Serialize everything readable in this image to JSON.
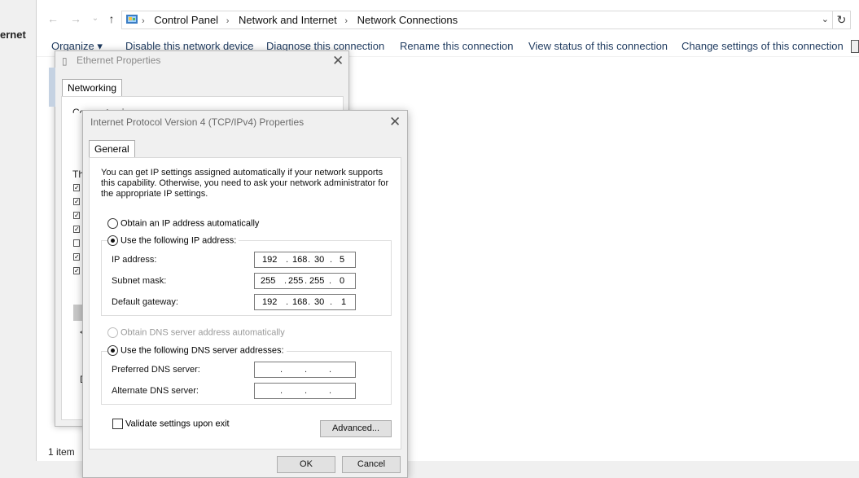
{
  "background": {
    "left_fragment": "ernet"
  },
  "explorer": {
    "breadcrumbs": [
      "Control Panel",
      "Network and Internet",
      "Network Connections"
    ],
    "commands": [
      "Organize ▾",
      "Disable this network device",
      "Diagnose this connection",
      "Rename this connection",
      "View status of this connection",
      "Change settings of this connection"
    ],
    "status": "1 item"
  },
  "ethernet_dialog": {
    "title": "Ethernet Properties",
    "tab": "Networking",
    "fragment_connect": "Connect using:",
    "fragment_this": "Th",
    "fragment_d": "D",
    "fragment_scroll": "<"
  },
  "ipv4_dialog": {
    "title": "Internet Protocol Version 4 (TCP/IPv4) Properties",
    "tab": "General",
    "description": "You can get IP settings assigned automatically if your network supports this capability. Otherwise, you need to ask your network administrator for the appropriate IP settings.",
    "radio_auto_ip": "Obtain an IP address automatically",
    "radio_manual_ip": "Use the following IP address:",
    "ip_label": "IP address:",
    "ip_address": [
      "192",
      "168",
      "30",
      "5"
    ],
    "subnet_label": "Subnet mask:",
    "subnet_mask": [
      "255",
      "255",
      "255",
      "0"
    ],
    "gateway_label": "Default gateway:",
    "gateway": [
      "192",
      "168",
      "30",
      "1"
    ],
    "radio_auto_dns": "Obtain DNS server address automatically",
    "radio_manual_dns": "Use the following DNS server addresses:",
    "preferred_dns_label": "Preferred DNS server:",
    "alternate_dns_label": "Alternate DNS server:",
    "validate_label": "Validate settings upon exit",
    "advanced_button": "Advanced...",
    "ok_button": "OK",
    "cancel_button": "Cancel"
  }
}
